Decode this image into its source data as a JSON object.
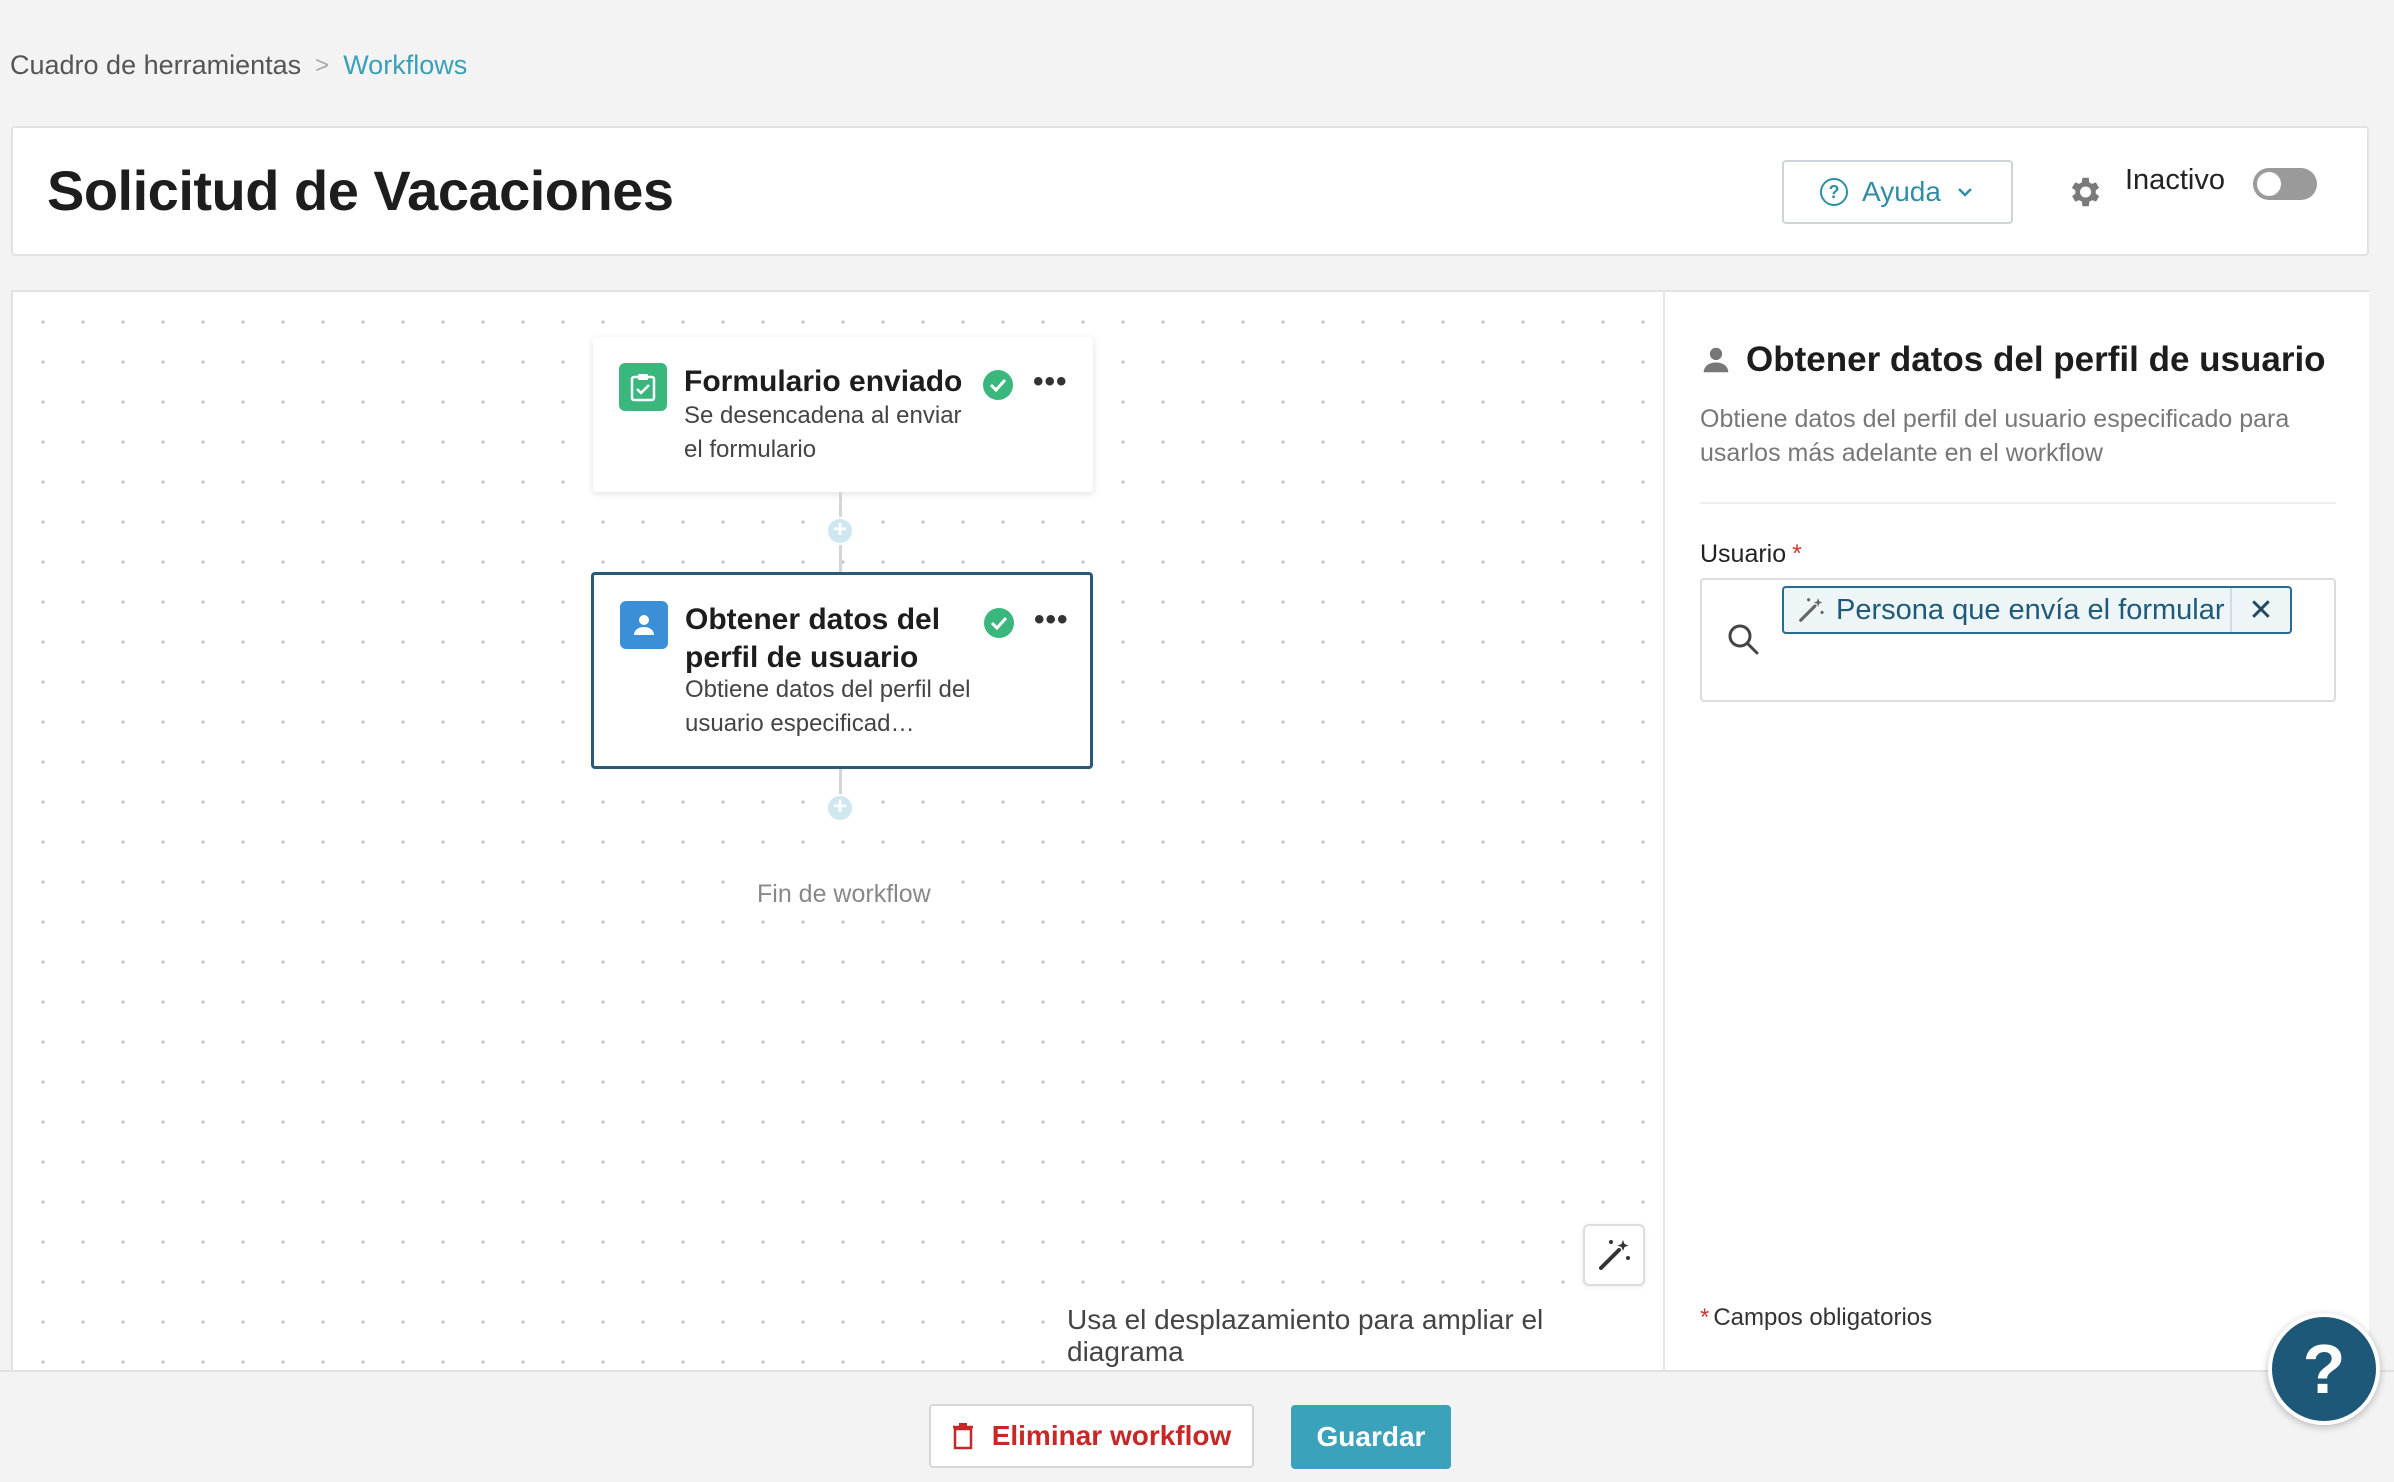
{
  "breadcrumb": {
    "root": "Cuadro de herramientas",
    "separator": ">",
    "current": "Workflows"
  },
  "header": {
    "title": "Solicitud de Vacaciones",
    "help_label": "Ayuda",
    "status_label": "Inactivo",
    "active": false
  },
  "workflow": {
    "trigger": {
      "title": "Formulario enviado",
      "description": "Se desencadena al enviar el formulario",
      "icon": "form-check-icon"
    },
    "action": {
      "title": "Obtener datos del perfil de usuario",
      "description": "Obtiene datos del perfil del usuario especificad…",
      "icon": "user-icon"
    },
    "more_label": "•••",
    "end_label": "Fin de workflow",
    "zoom_hint": "Usa el desplazamiento para ampliar el diagrama"
  },
  "side_panel": {
    "title": "Obtener datos del perfil de usuario",
    "description": "Obtiene datos del perfil del usuario especificado para usarlos más adelante en el workflow",
    "field_label": "Usuario",
    "required_mark": "*",
    "chip_value": "Persona que envía el formular",
    "chip_close": "✕",
    "required_note": "Campos obligatorios"
  },
  "footer": {
    "delete_label": "Eliminar workflow",
    "save_label": "Guardar",
    "help_fab": "?"
  },
  "colors": {
    "accent": "#3aa3bb",
    "link": "#3aa0b8",
    "success": "#3ab77c",
    "danger": "#c62828",
    "node_border": "#2a5a7a"
  }
}
